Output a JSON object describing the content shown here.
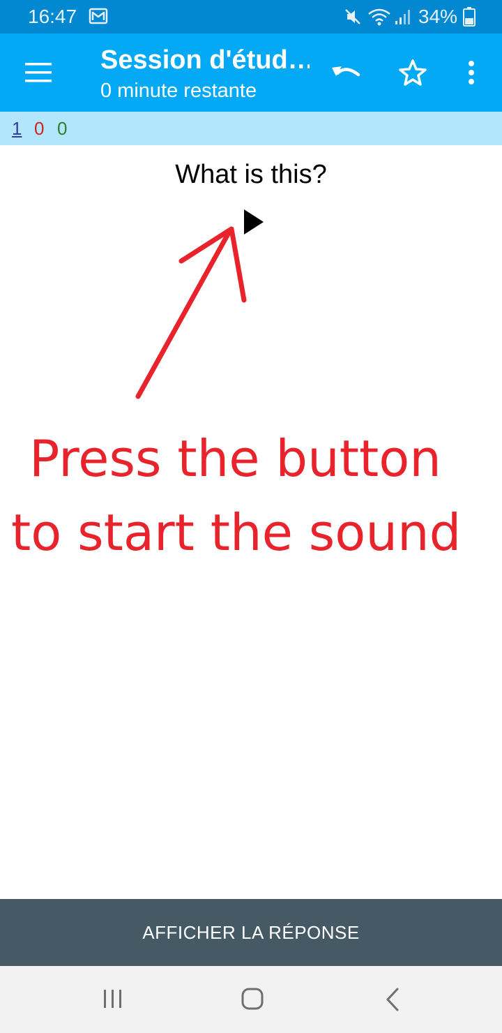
{
  "status_bar": {
    "time": "16:47",
    "battery_percent": "34%",
    "icons": [
      "gmail-icon",
      "mute-icon",
      "wifi-icon",
      "signal-icon",
      "battery-icon"
    ]
  },
  "toolbar": {
    "title": "Session d'étud…",
    "subtitle": "0 minute restante",
    "icons": [
      "menu-icon",
      "undo-icon",
      "star-icon",
      "more-vert-icon"
    ]
  },
  "counts": {
    "new": "1",
    "learning": "0",
    "review": "0",
    "colors": {
      "new": "#303f9f",
      "learning": "#c62828",
      "review": "#2e7d32"
    }
  },
  "card": {
    "question": "What is this?",
    "play_icon": "play-icon"
  },
  "annotation": {
    "line1": "Press the button",
    "line2": "to start the sound",
    "color": "#e8232c"
  },
  "answer_button": {
    "label": "AFFICHER LA RÉPONSE"
  },
  "nav_bar": {
    "icons": [
      "recents-icon",
      "home-icon",
      "back-icon"
    ]
  },
  "colors": {
    "status_bar": "#0288d1",
    "toolbar": "#03a9f4",
    "counts_bar": "#b3e5fc",
    "answer_bar": "#455a64"
  }
}
